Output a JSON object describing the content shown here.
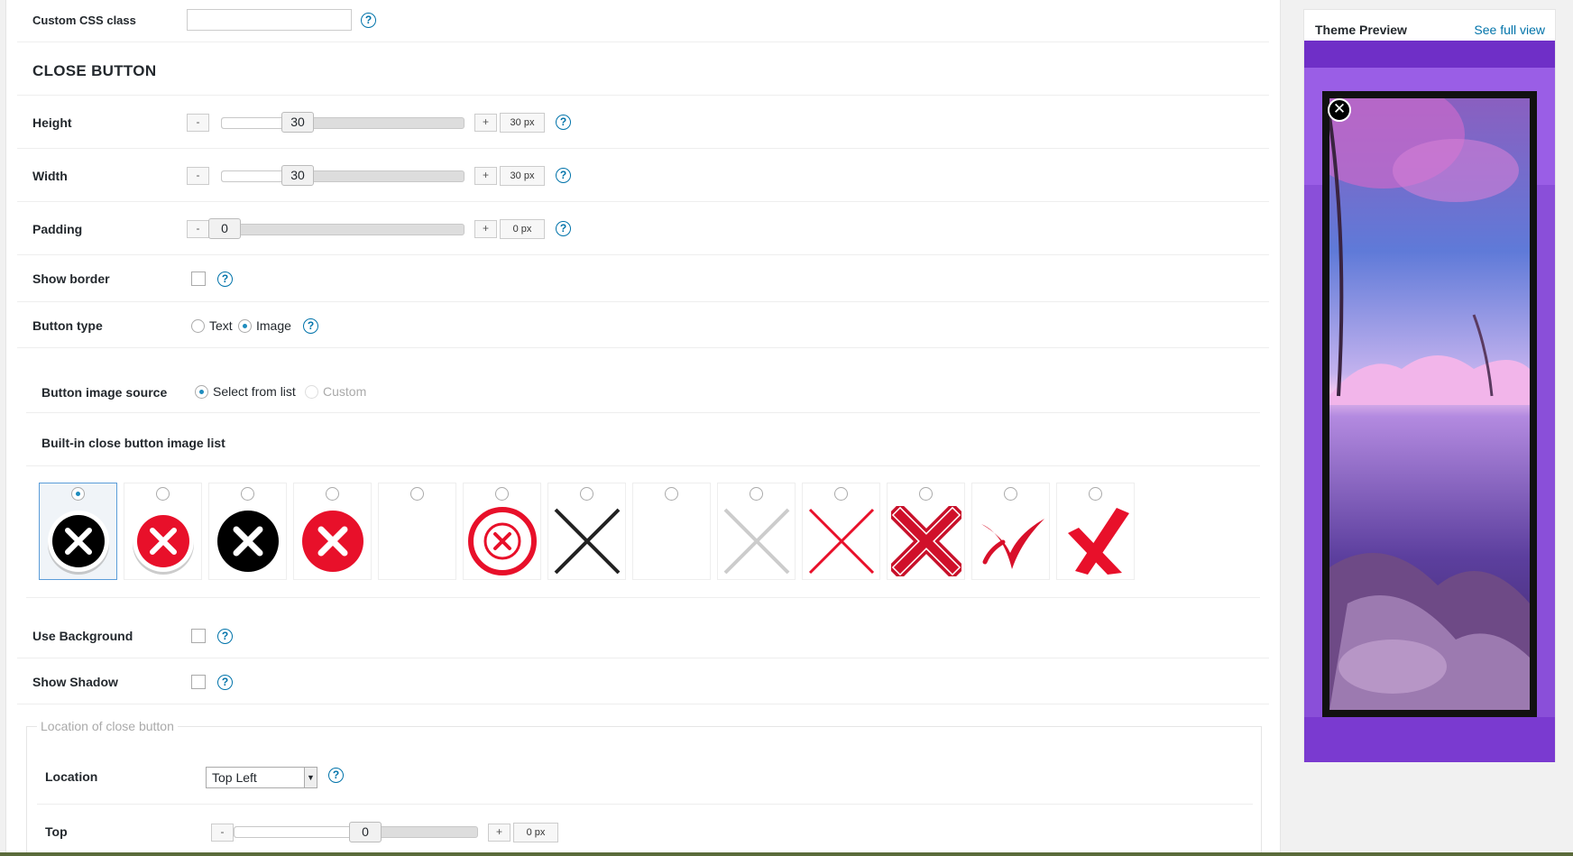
{
  "custom_css": {
    "label": "Custom CSS class",
    "value": "",
    "help": "?"
  },
  "close_button": {
    "title": "CLOSE BUTTON",
    "height": {
      "label": "Height",
      "minus": "-",
      "plus": "+",
      "value": "30",
      "unit_value": "30 px",
      "fraction": 0.28
    },
    "width": {
      "label": "Width",
      "minus": "-",
      "plus": "+",
      "value": "30",
      "unit_value": "30 px",
      "fraction": 0.28
    },
    "padding": {
      "label": "Padding",
      "minus": "-",
      "plus": "+",
      "value": "0",
      "unit_value": "0 px",
      "fraction": 0.0
    },
    "show_border": {
      "label": "Show border",
      "checked": false
    },
    "button_type": {
      "label": "Button type",
      "options": [
        "Text",
        "Image"
      ],
      "selected": "Image"
    },
    "image_source": {
      "label": "Button image source",
      "options": [
        "Select from list",
        "Custom"
      ],
      "selected": "Select from list"
    },
    "image_list": {
      "label": "Built-in close button image list",
      "selected_index": 0,
      "items": [
        "black-circle-x-icon",
        "red-circle-shadow-x-icon",
        "black-circle-x-icon",
        "red-circle-x-icon",
        "empty-icon",
        "red-ring-x-icon",
        "black-x-icon",
        "empty-icon",
        "gray-x-icon",
        "red-thin-x-icon",
        "red-bold-x-icon",
        "red-brush-x-icon",
        "red-slash-x-icon"
      ]
    },
    "use_background": {
      "label": "Use Background",
      "checked": false
    },
    "show_shadow": {
      "label": "Show Shadow",
      "checked": false
    },
    "location_group": {
      "legend": "Location of close button",
      "location": {
        "label": "Location",
        "value": "Top Left"
      },
      "top": {
        "label": "Top",
        "minus": "-",
        "plus": "+",
        "value": "0",
        "unit_value": "0 px",
        "fraction": 0.5
      }
    }
  },
  "preview": {
    "title": "Theme Preview",
    "link": "See full view",
    "close_glyph": "✕"
  },
  "colors": {
    "accent": "#0073aa",
    "preview_bg": "#8a4fd9",
    "red": "#e8102a"
  }
}
